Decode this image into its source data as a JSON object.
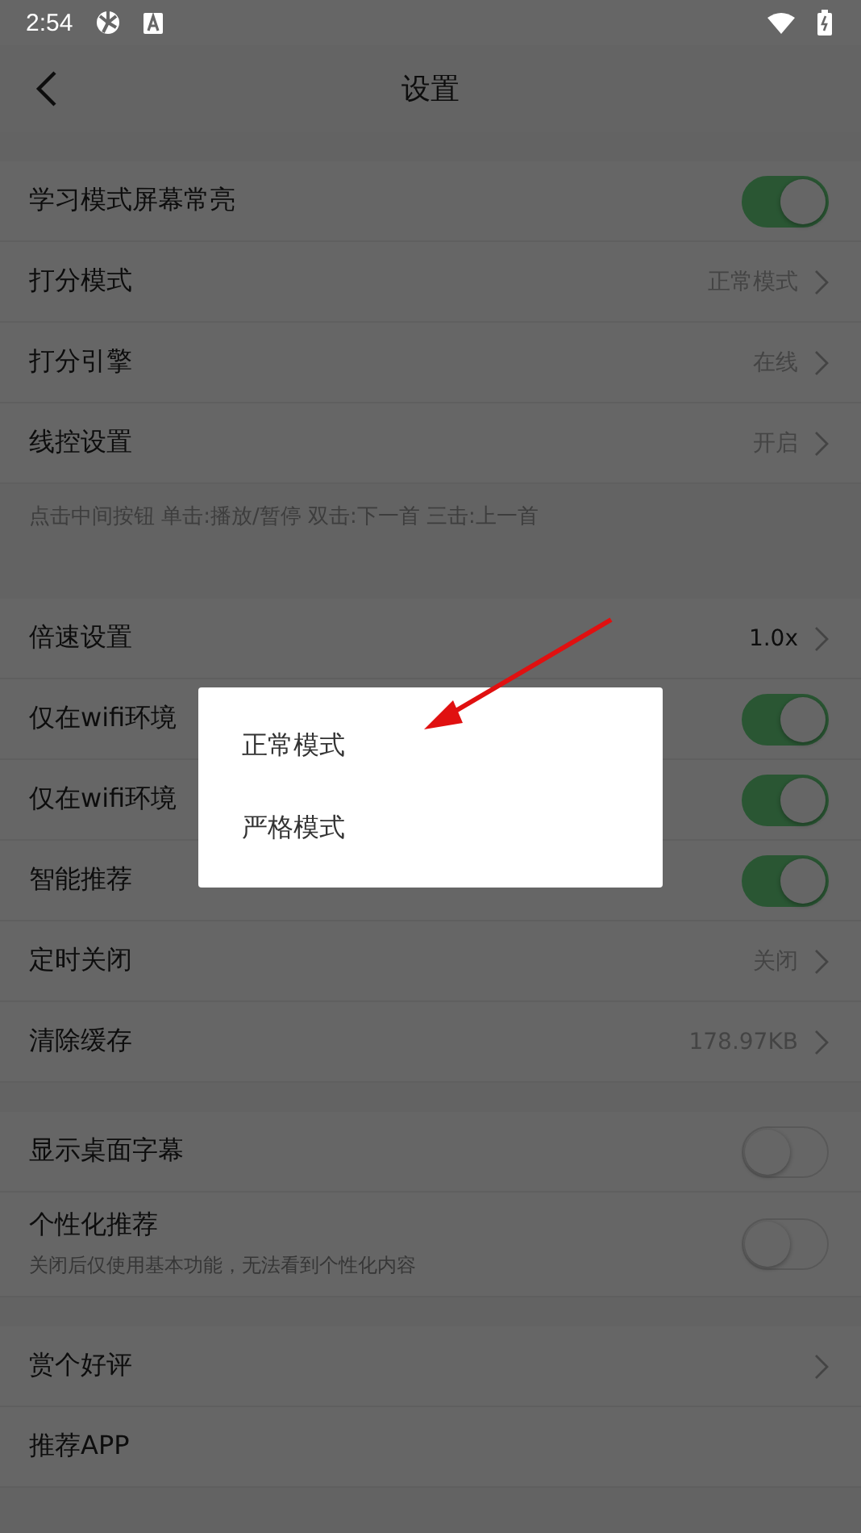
{
  "status_bar": {
    "time": "2:54"
  },
  "header": {
    "title": "设置"
  },
  "sections": [
    {
      "rows": [
        {
          "kind": "toggle",
          "label": "学习模式屏幕常亮",
          "on": true
        },
        {
          "kind": "link",
          "label": "打分模式",
          "value": "正常模式"
        },
        {
          "kind": "link",
          "label": "打分引擎",
          "value": "在线"
        },
        {
          "kind": "link",
          "label": "线控设置",
          "value": "开启"
        },
        {
          "kind": "note",
          "label": "点击中间按钮 单击:播放/暂停 双击:下一首 三击:上一首"
        }
      ]
    },
    {
      "rows": [
        {
          "kind": "link",
          "label": "倍速设置",
          "value": "1.0x",
          "strong": true
        },
        {
          "kind": "toggle",
          "label": "仅在wifi环境",
          "on": true
        },
        {
          "kind": "toggle",
          "label": "仅在wifi环境",
          "on": true
        },
        {
          "kind": "toggle",
          "label": "智能推荐",
          "on": true
        },
        {
          "kind": "link",
          "label": "定时关闭",
          "value": "关闭"
        },
        {
          "kind": "link",
          "label": "清除缓存",
          "value": "178.97KB"
        }
      ]
    },
    {
      "rows": [
        {
          "kind": "toggle",
          "label": "显示桌面字幕",
          "on": false
        },
        {
          "kind": "toggle",
          "label": "个性化推荐",
          "description": "关闭后仅使用基本功能，无法看到个性化内容",
          "on": false
        }
      ]
    },
    {
      "rows": [
        {
          "kind": "link",
          "label": "赏个好评"
        },
        {
          "kind": "link",
          "label": "推荐APP",
          "nochevron": true
        }
      ]
    }
  ],
  "dialog": {
    "options": [
      {
        "label": "正常模式"
      },
      {
        "label": "严格模式"
      }
    ]
  }
}
